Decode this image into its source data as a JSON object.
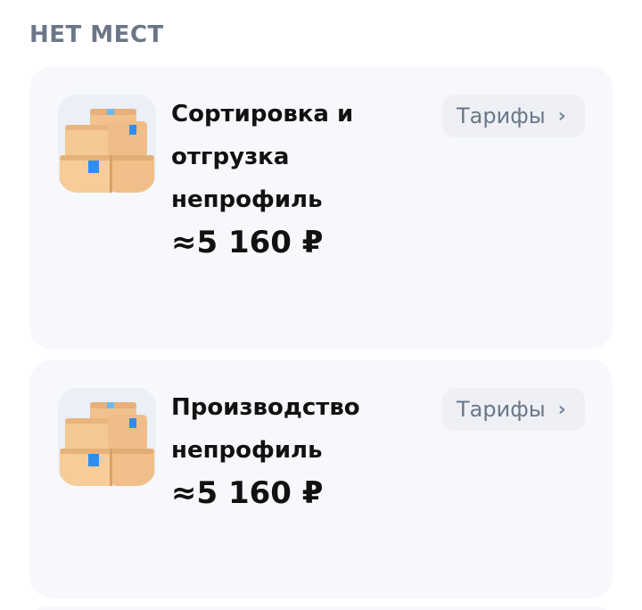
{
  "section": {
    "title": "НЕТ МЕСТ"
  },
  "cards": [
    {
      "name_lines": [
        "Сортировка и",
        "отгрузка",
        "непрофиль"
      ],
      "price": "≈5 160 ₽",
      "action_label": "Тарифы",
      "image_icon": "boxes-icon"
    },
    {
      "name_lines": [
        "Производство",
        "непрофиль"
      ],
      "price": "≈5 160 ₽",
      "action_label": "Тарифы",
      "image_icon": "boxes-icon"
    }
  ],
  "icons": {
    "chevron": "chevron-right-icon"
  },
  "colors": {
    "section_title": "#6b7789",
    "card_bg": "#f7f8fc",
    "button_bg": "#eef0f6",
    "text_primary": "#111111",
    "box_accent": "#2f8df0"
  }
}
